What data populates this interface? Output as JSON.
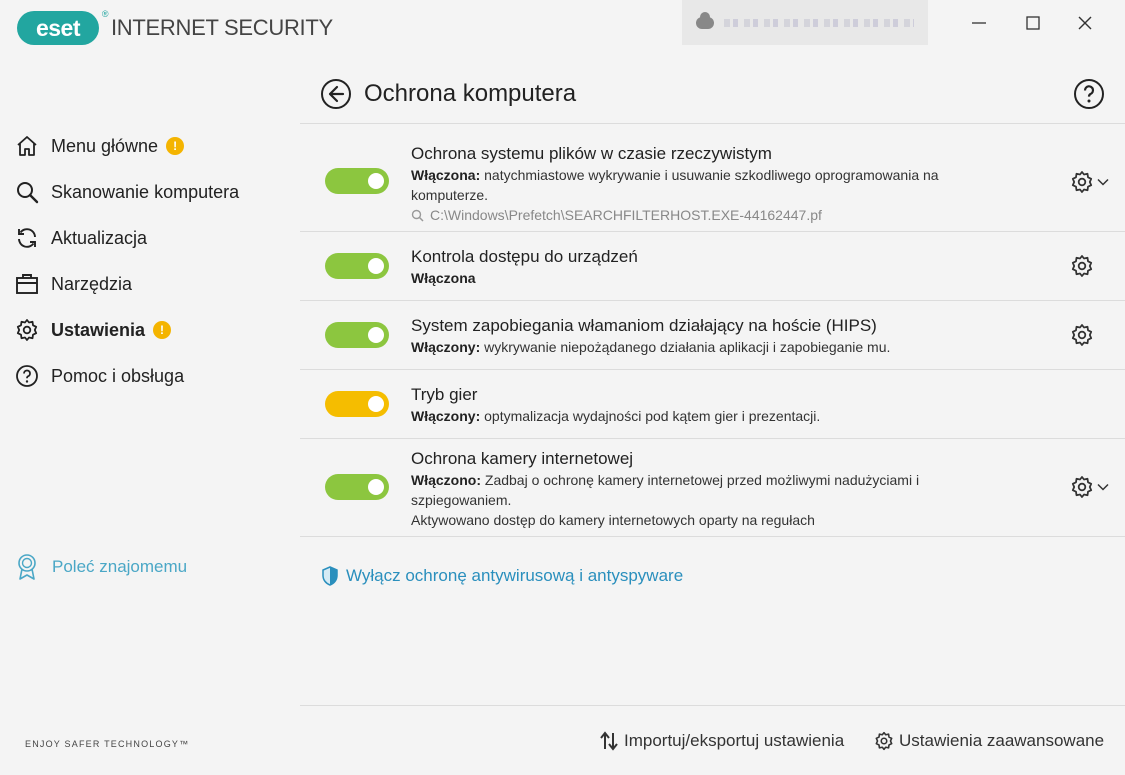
{
  "app": {
    "logo_text": "eset",
    "logo_mark": "®",
    "product_name": "INTERNET SECURITY"
  },
  "window_controls": {
    "minimize_icon": "minimize-icon",
    "maximize_icon": "maximize-icon",
    "close_icon": "close-icon"
  },
  "sidebar": {
    "items": [
      {
        "label": "Menu główne",
        "icon": "home-icon",
        "badge": "!"
      },
      {
        "label": "Skanowanie komputera",
        "icon": "magnifier-icon"
      },
      {
        "label": "Aktualizacja",
        "icon": "refresh-icon"
      },
      {
        "label": "Narzędzia",
        "icon": "toolbox-icon"
      },
      {
        "label": "Ustawienia",
        "icon": "gear-icon",
        "badge": "!",
        "active": true
      },
      {
        "label": "Pomoc i obsługa",
        "icon": "question-icon"
      }
    ],
    "refer_label": "Poleć znajomemu",
    "tagline": "ENJOY SAFER TECHNOLOGY™"
  },
  "page": {
    "title": "Ochrona komputera"
  },
  "modules": [
    {
      "title": "Ochrona systemu plików w czasie rzeczywistym",
      "status": "Włączona:",
      "description": "natychmiastowe wykrywanie i usuwanie szkodliwego oprogramowania na komputerze.",
      "path": "C:\\Windows\\Prefetch\\SEARCHFILTERHOST.EXE-44162447.pf",
      "toggle": "on",
      "color": "#8cc63f"
    },
    {
      "title": "Kontrola dostępu do urządzeń",
      "status": "Włączona",
      "description": "",
      "toggle": "on",
      "color": "#8cc63f"
    },
    {
      "title": "System zapobiegania włamaniom działający na hoście (HIPS)",
      "status": "Włączony:",
      "description": "wykrywanie niepożądanego działania aplikacji i zapobieganie mu.",
      "toggle": "on",
      "color": "#8cc63f"
    },
    {
      "title": "Tryb gier",
      "status": "Włączony:",
      "description": "optymalizacja wydajności pod kątem gier i prezentacji.",
      "toggle": "on",
      "color": "#f5bd00"
    },
    {
      "title": "Ochrona kamery internetowej",
      "status": "Włączono:",
      "description": "Zadbaj o ochronę kamery internetowej przed możliwymi nadużyciami i szpiegowaniem.",
      "extra": "Aktywowano dostęp do kamery internetowych oparty na regułach",
      "toggle": "on",
      "color": "#8cc63f"
    }
  ],
  "disable_link": "Wyłącz ochronę antywirusową i antyspyware",
  "footer": {
    "import_export": "Importuj/eksportuj ustawienia",
    "advanced": "Ustawienia zaawansowane"
  }
}
